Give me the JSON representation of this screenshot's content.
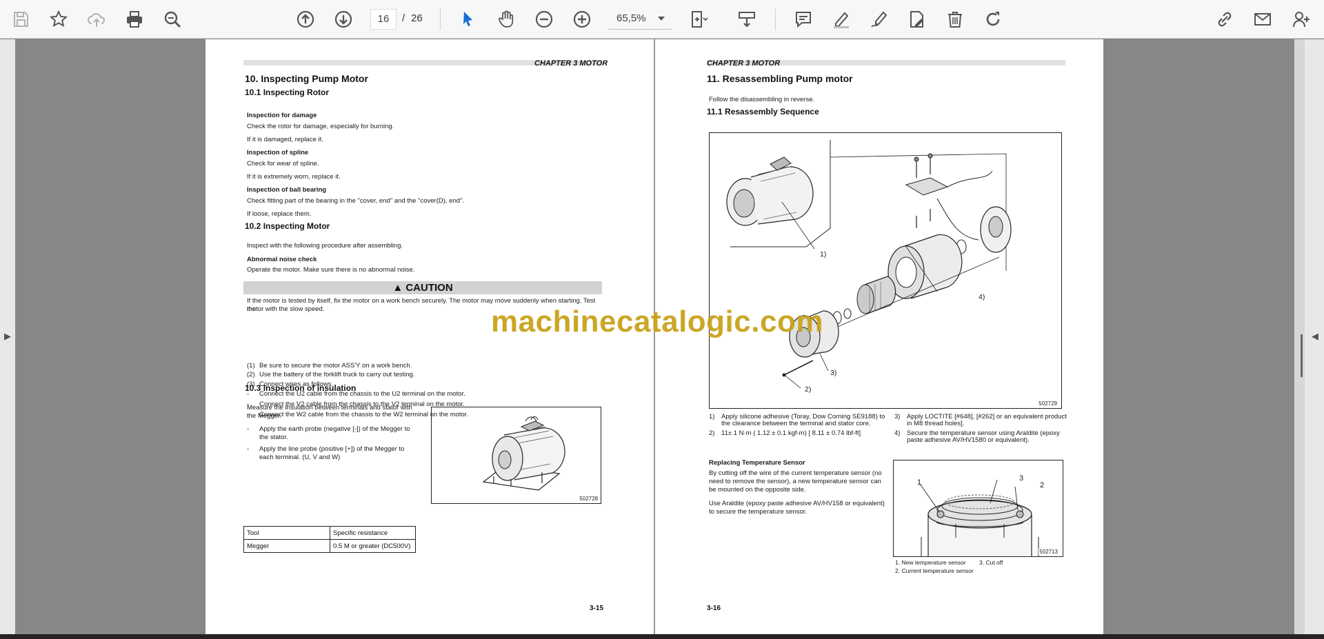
{
  "toolbar": {
    "current_page": "16",
    "separator": "/",
    "total_pages": "26",
    "zoom": "65,5%"
  },
  "left_page": {
    "chapter": "CHAPTER 3 MOTOR",
    "heading": "10.  Inspecting Pump Motor",
    "s101": "10.1    Inspecting Rotor",
    "damage_title": "Inspection for damage",
    "damage_1": "Check the rotor for damage, especially for burning.",
    "damage_2": "If it is damaged, replace it.",
    "spline_title": "Inspection of spline",
    "spline_1": "Check for wear of spline.",
    "spline_2": "If it is extremely worn, replace it.",
    "bearing_title": "Inspection of ball bearing",
    "bearing_1": "Check fitting part of the bearing in the \"cover, end\" and the \"cover(D), end\".",
    "bearing_2": "If loose, replace them.",
    "s102": "10.2    Inspecting Motor",
    "motor_intro": "Inspect with the following procedure after assembling.",
    "noise_title": "Abnormal noise check",
    "noise_1": "Operate the motor. Make sure there is no abnormal noise.",
    "caution_label": "▲ CAUTION",
    "caution_text_1": "If the motor is tested by itself, fix the motor on a work bench securely.  The motor may move suddenly when starting.  Test the",
    "caution_text_2": "motor with the slow speed.",
    "steps": [
      {
        "n": "(1)",
        "t": "Be sure to secure the motor ASS'Y on a work bench."
      },
      {
        "n": "(2)",
        "t": "Use the battery of the forklift truck to carry out testing."
      },
      {
        "n": "(3)",
        "t": "Connect wires as follows."
      },
      {
        "n": "-",
        "t": "Connect the U2 cable from the chassis to the U2 terminal on the motor."
      },
      {
        "n": "-",
        "t": "Connect the V2 cable from the chassis to the V2 terminal on the motor."
      },
      {
        "n": "-",
        "t": "Connect the W2 cable from the chassis to the W2 terminal on the motor."
      }
    ],
    "s103": "10.3    Inspection of insulation",
    "ins_1": "Measure the insulation between terminals and stator with",
    "ins_2": "the Megger.",
    "probe_1a": "Apply the earth probe (negative [-]) of the Megger to",
    "probe_1b": "the stator.",
    "probe_2a": "Apply the line probe (positive [+]) of the Megger to",
    "probe_2b": "each terminal. (U, V and W)",
    "dash": "-",
    "fig_num": "502728",
    "table": [
      [
        "Tool",
        "Specific resistance"
      ],
      [
        "Megger",
        "0.5 M or greater (DC500V)"
      ]
    ],
    "page_number": "3-15"
  },
  "right_page": {
    "chapter": "CHAPTER 3 MOTOR",
    "heading": "11.  Resassembling Pump motor",
    "intro": "Follow the disassembling in reverse.",
    "s111": "11.1    Resassembly Sequence",
    "fig_num": "502729",
    "callouts": [
      "1)",
      "2)",
      "3)",
      "4)"
    ],
    "notes": [
      {
        "n": "1)",
        "t1": "Apply silicone adhesive (Toray, Dow Corning SE9188) to",
        "t2": "the clearance between the terminal and stator core."
      },
      {
        "n": "2)",
        "t1": "11± 1 N·m ( 1.12 ± 0.1 kgf-m) [ 8.11 ± 0.74 lbf-ft]",
        "t2": ""
      },
      {
        "n": "3)",
        "t1": "Apply LOCTITE [#648], [#262] or an equivalent product",
        "t2": "in M8 thread holes]."
      },
      {
        "n": "4)",
        "t1": "Secure the temperature sensor using Araldite (epoxy",
        "t2": "paste adhesive AV/HV1580 or equivalent)."
      }
    ],
    "sensor_title": "Replacing Temperature Sensor",
    "sensor_1": "By cutting off the wire of the current temperature sensor (no",
    "sensor_2": "need to remove the sensor), a new temperature sensor can",
    "sensor_3": "be mounted on the opposite side.",
    "sensor_4": "Use Araldite (epoxy paste adhesive AV/HV158 or equivalent)",
    "sensor_5": "to secure the temperature sensor.",
    "fig2_num": "502713",
    "fig2_labels": [
      "1",
      "3",
      "2"
    ],
    "legend_1": "1. New temperature sensor",
    "legend_3": "3. Cut off",
    "legend_2": "2. Current temperature sensor",
    "page_number": "3-16"
  },
  "watermark": "machinecatalogic.com"
}
